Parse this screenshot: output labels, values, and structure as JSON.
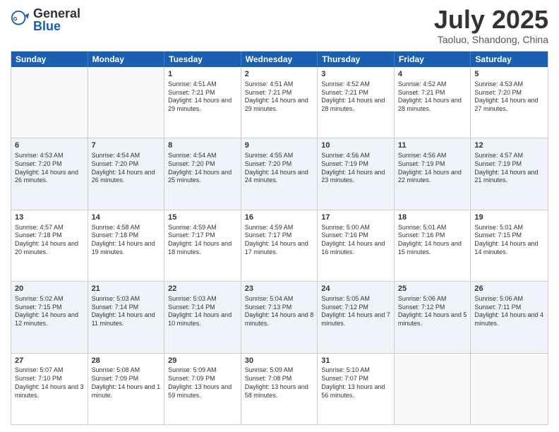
{
  "header": {
    "logo": {
      "general": "General",
      "blue": "Blue"
    },
    "title": "July 2025",
    "location": "Taoluo, Shandong, China"
  },
  "days": [
    "Sunday",
    "Monday",
    "Tuesday",
    "Wednesday",
    "Thursday",
    "Friday",
    "Saturday"
  ],
  "weeks": [
    [
      {
        "day": "",
        "info": ""
      },
      {
        "day": "",
        "info": ""
      },
      {
        "day": "1",
        "info": "Sunrise: 4:51 AM\nSunset: 7:21 PM\nDaylight: 14 hours and 29 minutes."
      },
      {
        "day": "2",
        "info": "Sunrise: 4:51 AM\nSunset: 7:21 PM\nDaylight: 14 hours and 29 minutes."
      },
      {
        "day": "3",
        "info": "Sunrise: 4:52 AM\nSunset: 7:21 PM\nDaylight: 14 hours and 28 minutes."
      },
      {
        "day": "4",
        "info": "Sunrise: 4:52 AM\nSunset: 7:21 PM\nDaylight: 14 hours and 28 minutes."
      },
      {
        "day": "5",
        "info": "Sunrise: 4:53 AM\nSunset: 7:20 PM\nDaylight: 14 hours and 27 minutes."
      }
    ],
    [
      {
        "day": "6",
        "info": "Sunrise: 4:53 AM\nSunset: 7:20 PM\nDaylight: 14 hours and 26 minutes."
      },
      {
        "day": "7",
        "info": "Sunrise: 4:54 AM\nSunset: 7:20 PM\nDaylight: 14 hours and 26 minutes."
      },
      {
        "day": "8",
        "info": "Sunrise: 4:54 AM\nSunset: 7:20 PM\nDaylight: 14 hours and 25 minutes."
      },
      {
        "day": "9",
        "info": "Sunrise: 4:55 AM\nSunset: 7:20 PM\nDaylight: 14 hours and 24 minutes."
      },
      {
        "day": "10",
        "info": "Sunrise: 4:56 AM\nSunset: 7:19 PM\nDaylight: 14 hours and 23 minutes."
      },
      {
        "day": "11",
        "info": "Sunrise: 4:56 AM\nSunset: 7:19 PM\nDaylight: 14 hours and 22 minutes."
      },
      {
        "day": "12",
        "info": "Sunrise: 4:57 AM\nSunset: 7:19 PM\nDaylight: 14 hours and 21 minutes."
      }
    ],
    [
      {
        "day": "13",
        "info": "Sunrise: 4:57 AM\nSunset: 7:18 PM\nDaylight: 14 hours and 20 minutes."
      },
      {
        "day": "14",
        "info": "Sunrise: 4:58 AM\nSunset: 7:18 PM\nDaylight: 14 hours and 19 minutes."
      },
      {
        "day": "15",
        "info": "Sunrise: 4:59 AM\nSunset: 7:17 PM\nDaylight: 14 hours and 18 minutes."
      },
      {
        "day": "16",
        "info": "Sunrise: 4:59 AM\nSunset: 7:17 PM\nDaylight: 14 hours and 17 minutes."
      },
      {
        "day": "17",
        "info": "Sunrise: 5:00 AM\nSunset: 7:16 PM\nDaylight: 14 hours and 16 minutes."
      },
      {
        "day": "18",
        "info": "Sunrise: 5:01 AM\nSunset: 7:16 PM\nDaylight: 14 hours and 15 minutes."
      },
      {
        "day": "19",
        "info": "Sunrise: 5:01 AM\nSunset: 7:15 PM\nDaylight: 14 hours and 14 minutes."
      }
    ],
    [
      {
        "day": "20",
        "info": "Sunrise: 5:02 AM\nSunset: 7:15 PM\nDaylight: 14 hours and 12 minutes."
      },
      {
        "day": "21",
        "info": "Sunrise: 5:03 AM\nSunset: 7:14 PM\nDaylight: 14 hours and 11 minutes."
      },
      {
        "day": "22",
        "info": "Sunrise: 5:03 AM\nSunset: 7:14 PM\nDaylight: 14 hours and 10 minutes."
      },
      {
        "day": "23",
        "info": "Sunrise: 5:04 AM\nSunset: 7:13 PM\nDaylight: 14 hours and 8 minutes."
      },
      {
        "day": "24",
        "info": "Sunrise: 5:05 AM\nSunset: 7:12 PM\nDaylight: 14 hours and 7 minutes."
      },
      {
        "day": "25",
        "info": "Sunrise: 5:06 AM\nSunset: 7:12 PM\nDaylight: 14 hours and 5 minutes."
      },
      {
        "day": "26",
        "info": "Sunrise: 5:06 AM\nSunset: 7:11 PM\nDaylight: 14 hours and 4 minutes."
      }
    ],
    [
      {
        "day": "27",
        "info": "Sunrise: 5:07 AM\nSunset: 7:10 PM\nDaylight: 14 hours and 3 minutes."
      },
      {
        "day": "28",
        "info": "Sunrise: 5:08 AM\nSunset: 7:09 PM\nDaylight: 14 hours and 1 minute."
      },
      {
        "day": "29",
        "info": "Sunrise: 5:09 AM\nSunset: 7:09 PM\nDaylight: 13 hours and 59 minutes."
      },
      {
        "day": "30",
        "info": "Sunrise: 5:09 AM\nSunset: 7:08 PM\nDaylight: 13 hours and 58 minutes."
      },
      {
        "day": "31",
        "info": "Sunrise: 5:10 AM\nSunset: 7:07 PM\nDaylight: 13 hours and 56 minutes."
      },
      {
        "day": "",
        "info": ""
      },
      {
        "day": "",
        "info": ""
      }
    ]
  ]
}
